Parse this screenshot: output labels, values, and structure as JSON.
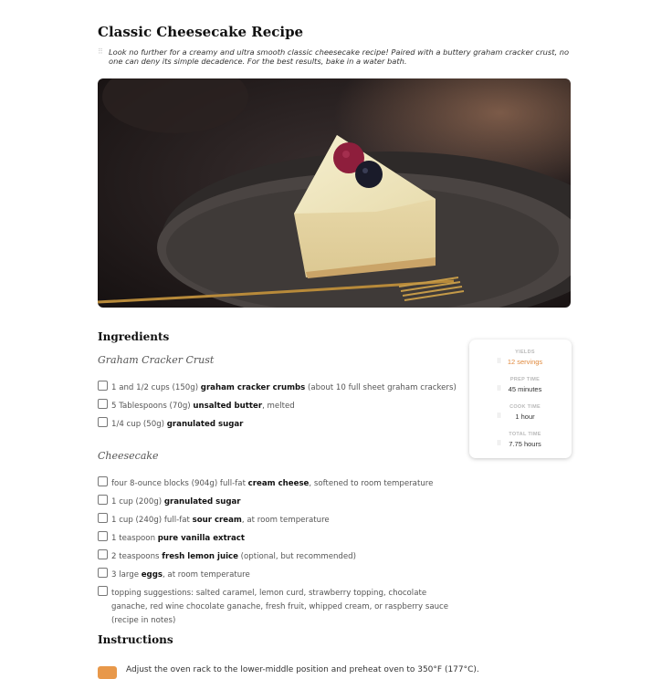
{
  "recipe": {
    "title": "Classic Cheesecake Recipe",
    "intro": "Look no further for a creamy and ultra smooth classic cheesecake recipe! Paired with a buttery graham cracker crust, no one can deny its simple decadence. For the best results, bake in a water bath."
  },
  "ingredients": {
    "heading": "Ingredients",
    "groups": [
      {
        "name": "Graham Cracker Crust",
        "items": [
          {
            "pre": "1 and 1/2 cups (150g) ",
            "bold": "graham cracker crumbs",
            "post": " (about 10 full sheet graham crackers)"
          },
          {
            "pre": "5 Tablespoons (70g) ",
            "bold": "unsalted butter",
            "post": ", melted"
          },
          {
            "pre": "1/4 cup (50g) ",
            "bold": "granulated sugar",
            "post": ""
          }
        ]
      },
      {
        "name": "Cheesecake",
        "items": [
          {
            "pre": "four 8-ounce blocks (904g) full-fat ",
            "bold": "cream cheese",
            "post": ", softened to room temperature"
          },
          {
            "pre": "1 cup (200g) ",
            "bold": "granulated sugar",
            "post": ""
          },
          {
            "pre": "1 cup (240g) full-fat ",
            "bold": "sour cream",
            "post": ", at room temperature"
          },
          {
            "pre": "1 teaspoon ",
            "bold": "pure vanilla extract",
            "post": ""
          },
          {
            "pre": "2 teaspoons ",
            "bold": "fresh lemon juice",
            "post": " (optional, but recommended)"
          },
          {
            "pre": "3 large ",
            "bold": "eggs",
            "post": ", at room temperature"
          },
          {
            "pre": "topping suggestions: salted caramel, lemon curd, strawberry topping, chocolate ganache, red wine chocolate ganache, fresh fruit, whipped cream, or raspberry sauce (recipe in notes)",
            "bold": "",
            "post": ""
          }
        ]
      }
    ]
  },
  "details": {
    "yields_label": "YIELDS",
    "yields_value": "12 servings",
    "prep_label": "PREP TIME",
    "prep_value": "45 minutes",
    "cook_label": "COOK TIME",
    "cook_value": "1 hour",
    "total_label": "TOTAL TIME",
    "total_value": "7.75 hours"
  },
  "instructions": {
    "heading": "Instructions",
    "step1": "Adjust the oven rack to the lower-middle position and preheat oven to 350°F (177°C)."
  },
  "colors": {
    "accent": "#e8984a",
    "yield_text": "#e08a3e"
  }
}
